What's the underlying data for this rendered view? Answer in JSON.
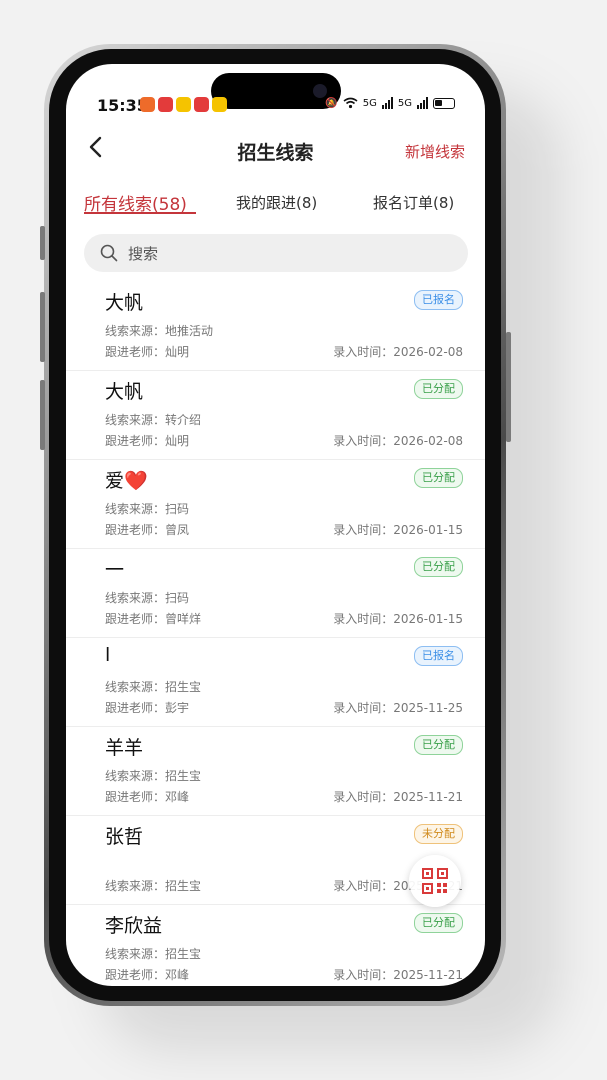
{
  "status_bar": {
    "time": "15:35",
    "signal1": "5G",
    "signal2": "5G"
  },
  "nav": {
    "back_icon": "chevron-left-icon",
    "title": "招生线索",
    "action": "新增线索"
  },
  "tabs": [
    {
      "label": "所有线索(58)",
      "active": true
    },
    {
      "label": "我的跟进(8)",
      "active": false
    },
    {
      "label": "报名订单(8)",
      "active": false
    }
  ],
  "search": {
    "placeholder": "搜索"
  },
  "leads": [
    {
      "name": "大帆",
      "status": "已报名",
      "source": "线索来源：地推活动",
      "teacher": "跟进老师：灿明",
      "time": "录入时间：2026-02-08"
    },
    {
      "name": "大帆",
      "status": "已分配",
      "source": "线索来源：转介绍",
      "teacher": "跟进老师：灿明",
      "time": "录入时间：2026-02-08"
    },
    {
      "name": "爱❤️",
      "status": "已分配",
      "source": "线索来源：扫码",
      "teacher": "跟进老师：曾凤",
      "time": "录入时间：2026-01-15"
    },
    {
      "name": "一",
      "status": "已分配",
      "source": "线索来源：扫码",
      "teacher": "跟进老师：曾咩烊",
      "time": "录入时间：2026-01-15"
    },
    {
      "name": "l",
      "status": "已报名",
      "source": "线索来源：招生宝",
      "teacher": "跟进老师：彭宇",
      "time": "录入时间：2025-11-25"
    },
    {
      "name": "羊羊",
      "status": "已分配",
      "source": "线索来源：招生宝",
      "teacher": "跟进老师：邓峰",
      "time": "录入时间：2025-11-21"
    },
    {
      "name": "张哲",
      "status": "未分配",
      "source": "线索来源：招生宝",
      "teacher": "",
      "time": "录入时间：2025-11-21"
    },
    {
      "name": "李欣益",
      "status": "已分配",
      "source": "线索来源：招生宝",
      "teacher": "跟进老师：邓峰",
      "time": "录入时间：2025-11-21"
    }
  ],
  "fab": {
    "icon": "qr-code-icon"
  }
}
